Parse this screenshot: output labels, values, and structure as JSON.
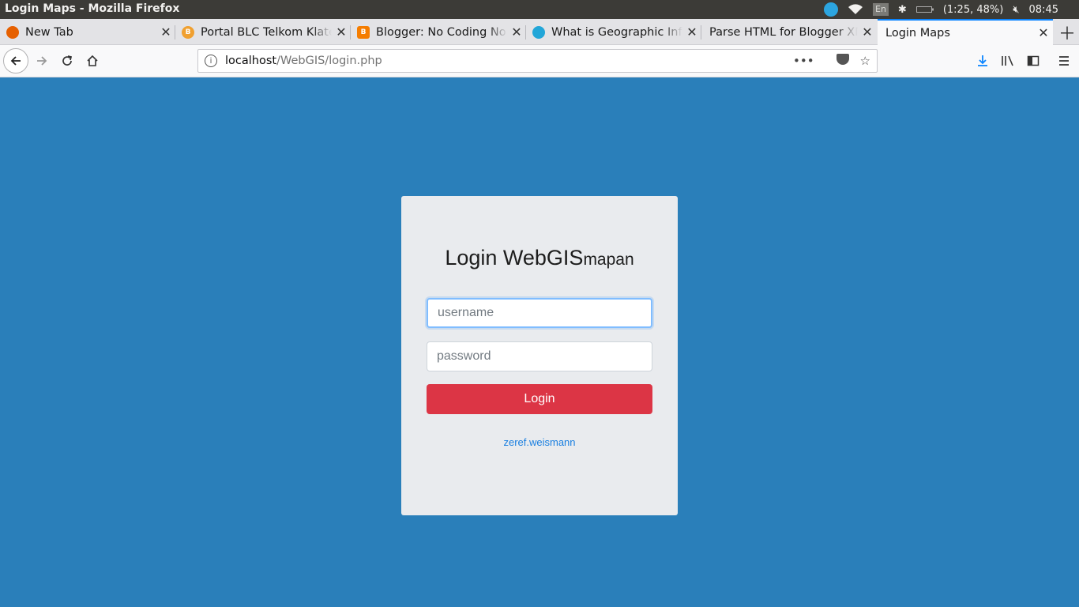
{
  "window": {
    "title": "Login Maps - Mozilla Firefox",
    "tray": {
      "lang": "En",
      "battery": "(1:25, 48%)",
      "clock": "08:45"
    }
  },
  "tabs": [
    {
      "label": "New Tab",
      "favicon": "firefox-icon",
      "color": "#e66000"
    },
    {
      "label": "Portal BLC Telkom Klaten",
      "favicon": "portal-icon",
      "color": "#f0a030"
    },
    {
      "label": "Blogger: No Coding No Life",
      "favicon": "blogger-icon",
      "color": "#f57d00"
    },
    {
      "label": "What is Geographic Information",
      "favicon": "gis-icon",
      "color": "#22a6d8"
    },
    {
      "label": "Parse HTML for Blogger XML",
      "favicon": "none",
      "color": ""
    },
    {
      "label": "Login Maps",
      "favicon": "none",
      "color": "",
      "active": true
    }
  ],
  "navbar": {
    "url_host": "localhost",
    "url_path": "/WebGIS/login.php"
  },
  "login": {
    "title": "Login WebGIS",
    "title_small": "mapan",
    "username_placeholder": "username",
    "password_placeholder": "password",
    "button_label": "Login",
    "credit": "zeref.weismann"
  },
  "colors": {
    "background": "#2a7fba",
    "card": "#e9ebee",
    "button": "#dc3545",
    "link": "#1a7fe0",
    "tab_accent": "#0a84ff"
  }
}
